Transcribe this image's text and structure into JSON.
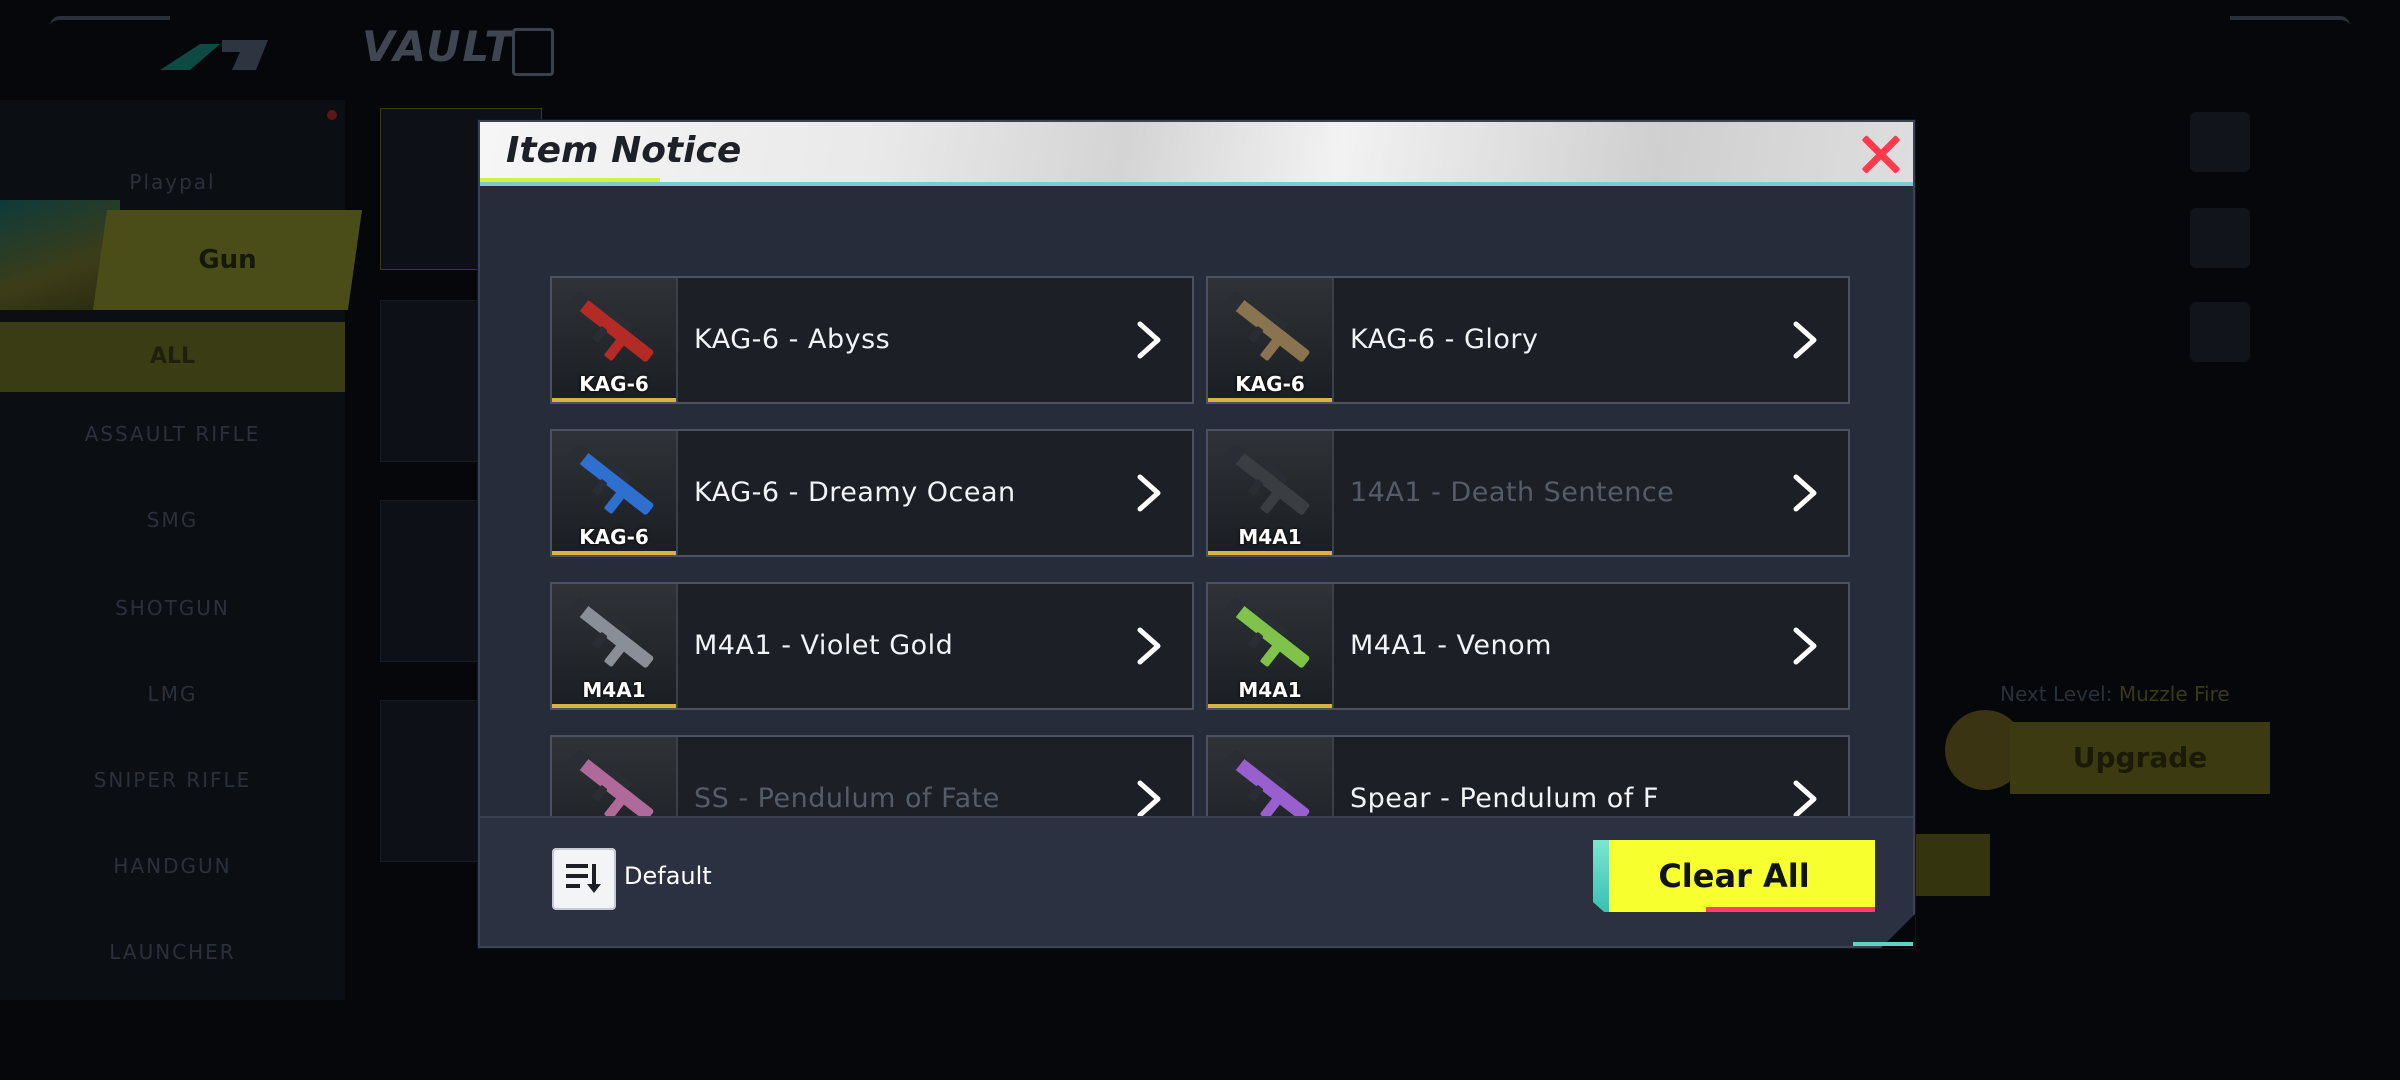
{
  "background": {
    "screen_title": "VAULT",
    "sidebar": {
      "category_label": "Playpal",
      "active_tab": "Gun",
      "subtabs": [
        "ALL",
        "ASSAULT RIFLE",
        "SMG",
        "SHOTGUN",
        "LMG",
        "SNIPER RIFLE",
        "HANDGUN",
        "LAUNCHER"
      ]
    },
    "next_level_label": "Next Level:",
    "next_level_value": "Muzzle Fire",
    "upgrade_label": "Upgrade"
  },
  "modal": {
    "title": "Item Notice",
    "items": [
      {
        "thumb_label": "KAG-6",
        "name": "KAG-6 - Abyss",
        "dim": false,
        "gun_color": "#b42a24"
      },
      {
        "thumb_label": "KAG-6",
        "name": "KAG-6 - Glory",
        "dim": false,
        "gun_color": "#8a7450"
      },
      {
        "thumb_label": "KAG-6",
        "name": "KAG-6 - Dreamy Ocean",
        "dim": false,
        "gun_color": "#2f6fd0"
      },
      {
        "thumb_label": "M4A1",
        "name": "14A1 - Death Sentence",
        "dim": true,
        "gun_color": "#3a3d42"
      },
      {
        "thumb_label": "M4A1",
        "name": "M4A1 - Violet Gold",
        "dim": false,
        "gun_color": "#8a8e96"
      },
      {
        "thumb_label": "M4A1",
        "name": "M4A1 - Venom",
        "dim": false,
        "gun_color": "#7fc34a"
      },
      {
        "thumb_label": "",
        "name": "SS - Pendulum of Fate",
        "dim": true,
        "gun_color": "#b06a9a"
      },
      {
        "thumb_label": "",
        "name": "Spear - Pendulum of F",
        "dim": false,
        "gun_color": "#9a5fcf"
      }
    ],
    "footer": {
      "sort_label": "Default",
      "clear_all_label": "Clear All"
    }
  },
  "colors": {
    "accent_yellow": "#f7ff2e",
    "close_red": "#ff3a4e",
    "rarity_gold": "#d7b43d",
    "cyan_accent": "#7dc9d6"
  }
}
